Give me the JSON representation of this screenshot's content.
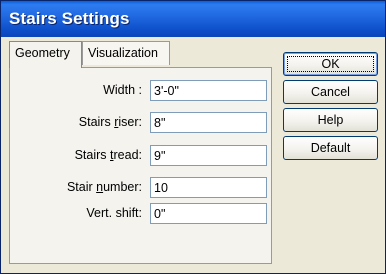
{
  "window": {
    "title": "Stairs Settings"
  },
  "tabs": [
    {
      "label": "Geometry",
      "active": true
    },
    {
      "label": "Visualization",
      "active": false
    }
  ],
  "fields": [
    {
      "label": "Width :",
      "value": "3'-0\""
    },
    {
      "label_pre": "Stairs ",
      "label_ul": "r",
      "label_post": "iser:",
      "value": "8\""
    },
    {
      "label_pre": "Stairs ",
      "label_ul": "t",
      "label_post": "read:",
      "value": "9\""
    },
    {
      "label_pre": "Stair ",
      "label_ul": "n",
      "label_post": "umber:",
      "value": "10"
    },
    {
      "label": "Vert. shift:",
      "value": "0\""
    }
  ],
  "buttons": {
    "ok": "OK",
    "cancel": "Cancel",
    "help": "Help",
    "default": "Default"
  }
}
